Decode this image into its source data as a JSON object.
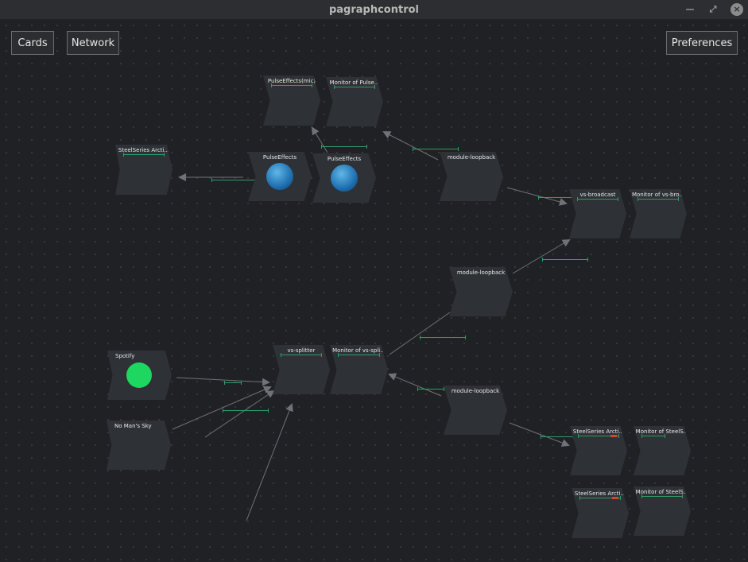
{
  "window": {
    "title": "pagraphcontrol"
  },
  "toolbar": {
    "cards": "Cards",
    "network": "Network",
    "preferences": "Preferences"
  },
  "colors": {
    "accent_meter": "#2f9e63",
    "peak": "#d2452f",
    "node_bg": "#2e3135"
  },
  "nodes": [
    {
      "id": "pe_mic",
      "label": "PulseEffects(mic)"
    },
    {
      "id": "mon_pulse",
      "label": "Monitor of Pulse..."
    },
    {
      "id": "steelseries_top",
      "label": "SteelSeries Arcti..."
    },
    {
      "id": "pe1",
      "label": "PulseEffects",
      "icon": "pulseeffects-icon"
    },
    {
      "id": "pe2",
      "label": "PulseEffects",
      "icon": "pulseeffects-icon"
    },
    {
      "id": "loop1",
      "label": "module-loopback"
    },
    {
      "id": "vsb",
      "label": "vs-broadcast"
    },
    {
      "id": "mon_vsb",
      "label": "Monitor of vs-bro..."
    },
    {
      "id": "loop2",
      "label": "module-loopback"
    },
    {
      "id": "spotify",
      "label": "Spotify",
      "icon": "spotify-icon"
    },
    {
      "id": "vss",
      "label": "vs-splitter"
    },
    {
      "id": "mon_vss",
      "label": "Monitor of vs-spli..."
    },
    {
      "id": "nms",
      "label": "No Man's Sky"
    },
    {
      "id": "loop3",
      "label": "module-loopback"
    },
    {
      "id": "ss2",
      "label": "SteelSeries Arcti..."
    },
    {
      "id": "mon_ss2",
      "label": "Monitor of SteelS..."
    },
    {
      "id": "ss3",
      "label": "SteelSeries Arcti..."
    },
    {
      "id": "mon_ss3",
      "label": "Monitor of SteelS..."
    }
  ]
}
